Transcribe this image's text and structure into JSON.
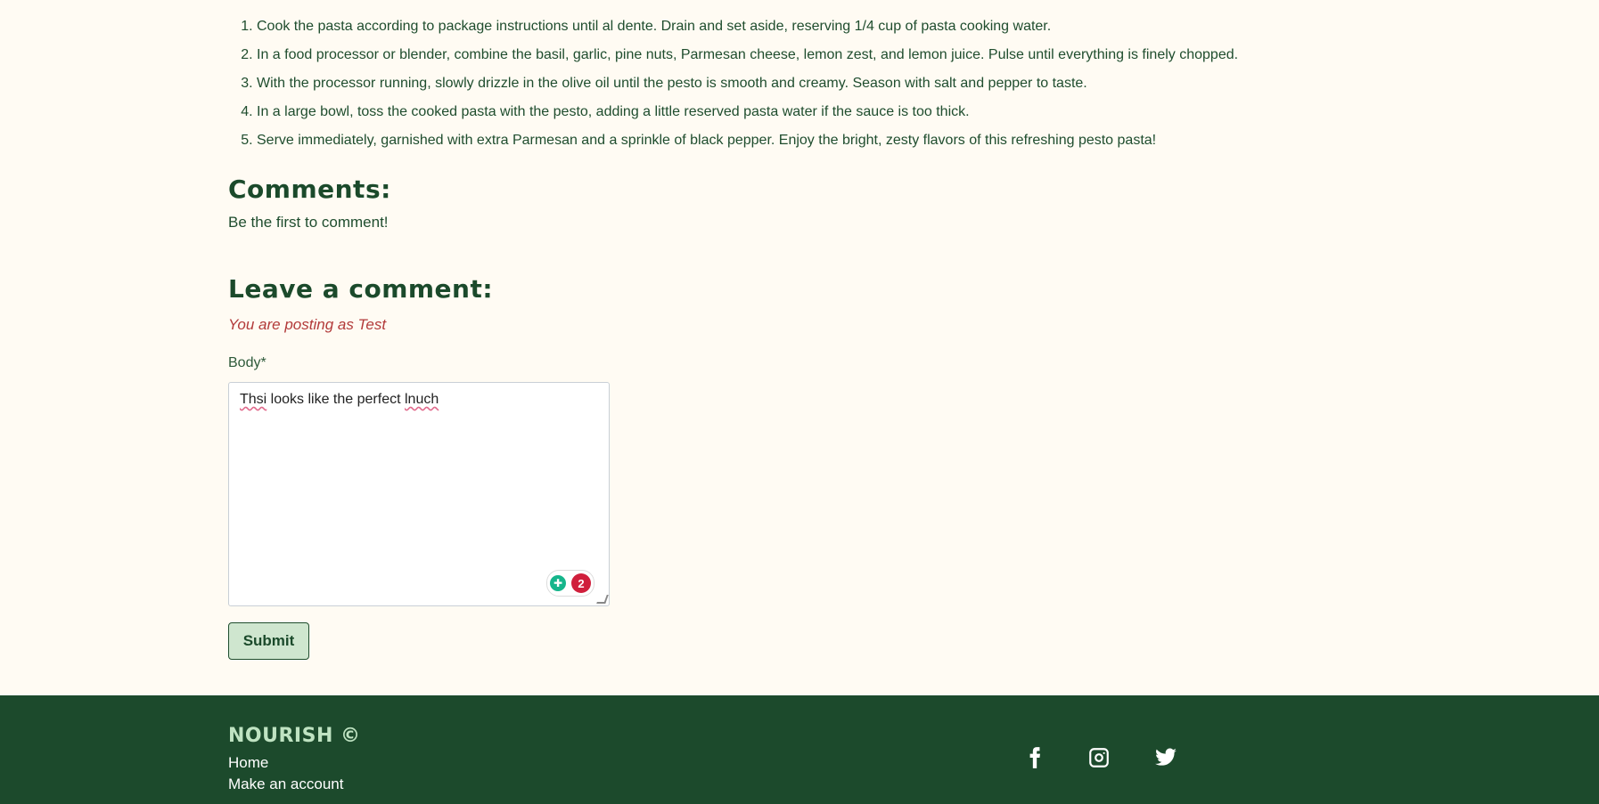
{
  "instructions": [
    "Cook the pasta according to package instructions until al dente. Drain and set aside, reserving 1/4 cup of pasta cooking water.",
    "In a food processor or blender, combine the basil, garlic, pine nuts, Parmesan cheese, lemon zest, and lemon juice. Pulse until everything is finely chopped.",
    "With the processor running, slowly drizzle in the olive oil until the pesto is smooth and creamy. Season with salt and pepper to taste.",
    "In a large bowl, toss the cooked pasta with the pesto, adding a little reserved pasta water if the sauce is too thick.",
    "Serve immediately, garnished with extra Parmesan and a sprinkle of black pepper. Enjoy the bright, zesty flavors of this refreshing pesto pasta!"
  ],
  "comments": {
    "title": "Comments:",
    "empty_text": "Be the first to comment!"
  },
  "comment_form": {
    "title": "Leave a comment:",
    "posting_as": "You are posting as Test",
    "body_label": "Body*",
    "body_value": {
      "word1": "Thsi",
      "middle": " looks like the perfect ",
      "word2": "lnuch"
    },
    "grammar_issue_count": "2",
    "submit_label": "Submit"
  },
  "footer": {
    "brand": "NOURISH ©",
    "links": [
      "Home",
      "Make an account"
    ],
    "social_icons": [
      "facebook-icon",
      "instagram-icon",
      "twitter-icon"
    ]
  },
  "colors": {
    "background": "#fffbf3",
    "primary_green": "#1c4a2c",
    "accent_light_green": "#cfe6cf",
    "error_red": "#b23a3a"
  }
}
